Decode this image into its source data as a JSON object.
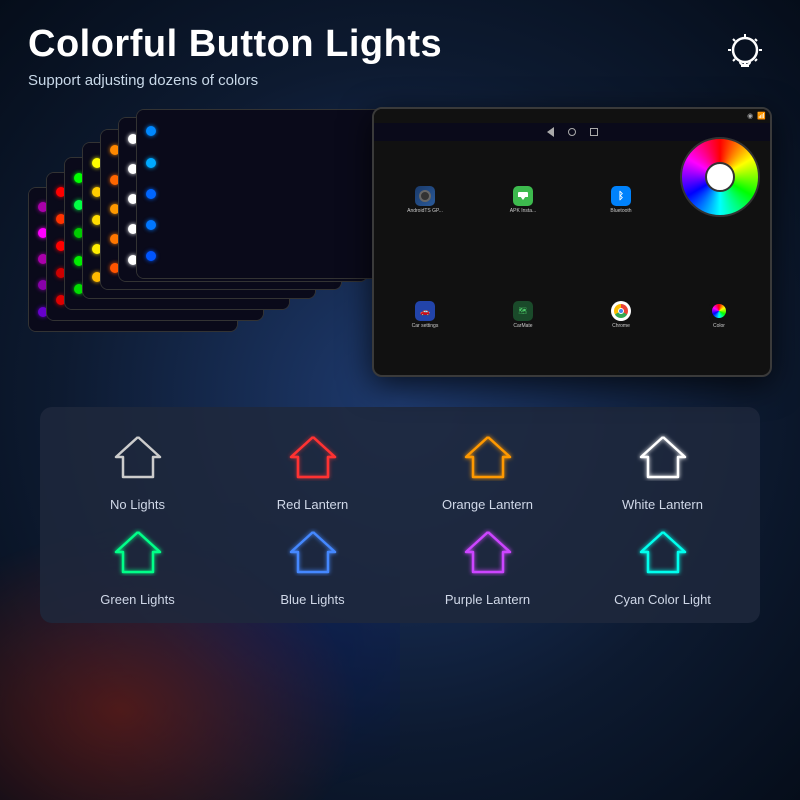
{
  "header": {
    "title": "Colorful Button Lights",
    "subtitle": "Support adjusting dozens of colors"
  },
  "top_lights": [
    {
      "label": "No Lights",
      "color": "#ffffff",
      "stroke": "#ffffff"
    },
    {
      "label": "Red Lantern",
      "color": "#ff3333",
      "stroke": "#ff3333"
    },
    {
      "label": "Orange Lantern",
      "color": "#ff9900",
      "stroke": "#ff9900"
    },
    {
      "label": "White Lantern",
      "color": "#ffffff",
      "stroke": "#ffffff"
    }
  ],
  "bottom_lights": [
    {
      "label": "Green Lights",
      "color": "#00ff88",
      "stroke": "#00ff88"
    },
    {
      "label": "Blue Lights",
      "color": "#4488ff",
      "stroke": "#4488ff"
    },
    {
      "label": "Purple Lantern",
      "color": "#cc44ff",
      "stroke": "#cc44ff"
    },
    {
      "label": "Cyan Color Light",
      "color": "#00ffee",
      "stroke": "#00ffee"
    }
  ],
  "button_colors_row1": [
    "#ff00ff",
    "#ff0000",
    "#00ff00",
    "#ffff00",
    "#ff8800",
    "#ff2222",
    "#8888ff",
    "#00aaff"
  ],
  "button_colors_row2": [
    "#cc00cc",
    "#ff4444",
    "#44ff44",
    "#dddd00",
    "#ff6600",
    "#ff6666",
    "#6666ff",
    "#0088dd"
  ],
  "device_count": 7
}
